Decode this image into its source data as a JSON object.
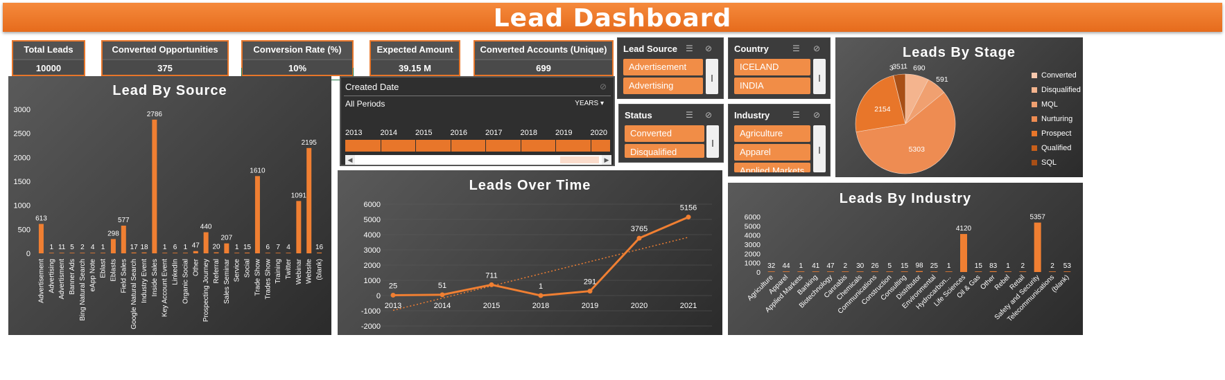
{
  "title": "Lead Dashboard",
  "kpis": [
    {
      "label": "Total Leads",
      "value": "10000"
    },
    {
      "label": "Converted Opportunities",
      "value": "375"
    },
    {
      "label": "Conversion Rate (%)",
      "value": "10%"
    },
    {
      "label": "Expected Amount",
      "value": "39.15 M"
    },
    {
      "label": "Converted Accounts (Unique)",
      "value": "699"
    }
  ],
  "slicers": {
    "lead_source": {
      "title": "Lead Source",
      "items": [
        "Advertisement",
        "Advertising"
      ]
    },
    "country": {
      "title": "Country",
      "items": [
        "ICELAND",
        "INDIA"
      ]
    },
    "status": {
      "title": "Status",
      "items": [
        "Converted",
        "Disqualified"
      ]
    },
    "industry": {
      "title": "Industry",
      "items": [
        "Agriculture",
        "Apparel",
        "Applied Markets"
      ]
    }
  },
  "timeline": {
    "title": "Created Date",
    "period_label": "All Periods",
    "level": "YEARS",
    "years": [
      "2013",
      "2014",
      "2015",
      "2016",
      "2017",
      "2018",
      "2019",
      "2020"
    ]
  },
  "colors": {
    "accent": "#e8762a",
    "bar": "#f07f32",
    "panel_dark": "#2b2b2b"
  },
  "chart_data": [
    {
      "type": "bar",
      "title": "Lead By Source",
      "categories": [
        "Advertisement",
        "Advertising",
        "Advertisment",
        "Banner Ads",
        "Bing Natural Search",
        "eApp Note",
        "Eblast",
        "Eblasts",
        "Field Sales",
        "Google Natural Search",
        "Industry Event",
        "Inside Sales",
        "Key Account Event",
        "LinkedIn",
        "Organic Social",
        "Other",
        "Prospecting Journey",
        "Referral",
        "Sales Seminar",
        "Service",
        "Social",
        "Trade Show",
        "Trades Show",
        "Training",
        "Twitter",
        "Webinar",
        "Website",
        "(blank)"
      ],
      "values": [
        613,
        1,
        11,
        5,
        2,
        4,
        1,
        298,
        577,
        17,
        18,
        2786,
        1,
        6,
        1,
        47,
        440,
        20,
        207,
        1,
        15,
        1610,
        6,
        7,
        4,
        1091,
        2195,
        16
      ],
      "ylim": [
        0,
        3000
      ],
      "yticks": [
        0,
        500,
        1000,
        1500,
        2000,
        2500,
        3000
      ]
    },
    {
      "type": "line",
      "title": "Leads Over Time",
      "x": [
        "2013",
        "2014",
        "2015",
        "2018",
        "2019",
        "2020",
        "2021"
      ],
      "values": [
        25,
        51,
        711,
        1,
        291,
        3765,
        5156
      ],
      "ylim": [
        -2000,
        6000
      ],
      "yticks": [
        -2000,
        -1000,
        0,
        1000,
        2000,
        3000,
        4000,
        5000,
        6000
      ],
      "trendline": true
    },
    {
      "type": "pie",
      "title": "Leads By Stage",
      "legend": [
        "Converted",
        "Disqualified",
        "MQL",
        "Nurturing",
        "Prospect",
        "Qualified",
        "SQL"
      ],
      "values": [
        1,
        690,
        591,
        5303,
        2154,
        3,
        351
      ],
      "colors": [
        "#f7c8ad",
        "#f4b48e",
        "#f0a070",
        "#ee8c52",
        "#e8762a",
        "#c85f1a",
        "#a84f16"
      ]
    },
    {
      "type": "bar",
      "title": "Leads By Industry",
      "categories": [
        "Agriculture",
        "Apparel",
        "Applied Markets",
        "Banking",
        "Biotechnology",
        "Cannabis",
        "Chemicals",
        "Communications",
        "Construction",
        "Consulting",
        "Distributor",
        "Environmental",
        "Hydrocarbon...",
        "Life Sciences",
        "Oil & Gas",
        "Other",
        "Rebel",
        "Retail",
        "Safety and Security",
        "Telecommunications",
        "(blank)"
      ],
      "values": [
        32,
        44,
        1,
        41,
        47,
        2,
        30,
        26,
        5,
        15,
        98,
        25,
        1,
        4120,
        15,
        83,
        1,
        2,
        5357,
        2,
        53
      ],
      "ylim": [
        0,
        6000
      ],
      "yticks": [
        0,
        1000,
        2000,
        3000,
        4000,
        5000,
        6000
      ]
    }
  ]
}
